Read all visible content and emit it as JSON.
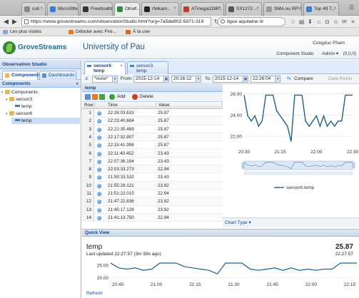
{
  "browser": {
    "tabs": [
      {
        "label": "coll...",
        "color": "#888888"
      },
      {
        "label": "MicroStre...",
        "color": "#3a7bd5"
      },
      {
        "label": "Freeboard",
        "color": "#333333"
      },
      {
        "label": "Obse...",
        "color": "#2d8a3a",
        "active": true
      },
      {
        "label": "rfelkam...",
        "color": "#222222"
      },
      {
        "label": "ATmega328P...",
        "color": "#c0392b"
      },
      {
        "label": "SX1272 ...",
        "color": "#555555"
      },
      {
        "label": "SMA ou RP-S...",
        "color": "#999999"
      },
      {
        "label": "Top 49 T...",
        "color": "#3a7bd5"
      }
    ],
    "url": "https://www.grovestreams.com/observationStudio.html?org=7a5de802-5d71-319",
    "search_value": "ligue aquitaine tir",
    "bookmarks": [
      "Les plus visités",
      "Débuter avec Fire...",
      "À la une"
    ]
  },
  "site": {
    "logo_text": "GroveStreams",
    "org_name": "University of Pau",
    "user": "Congduc Pham",
    "header_links": [
      "Component Studio",
      "Admin",
      "(0,0,0)"
    ]
  },
  "left": {
    "title": "Observation Studio",
    "tabs": [
      "Components",
      "Dashboards"
    ],
    "tree_title": "Components",
    "tree": [
      {
        "label": "Components",
        "type": "folder"
      },
      {
        "label": "sensor3",
        "type": "folder"
      },
      {
        "label": "temp",
        "type": "stream"
      },
      {
        "label": "sensor6",
        "type": "folder"
      },
      {
        "label": "temp",
        "type": "stream",
        "selected": true
      }
    ]
  },
  "stream_tabs": [
    {
      "line1": "sensor6",
      "line2": "temp"
    },
    {
      "line1": "sensor3",
      "line2": "temp"
    }
  ],
  "timebar": {
    "range": "*none*",
    "from_label": "From:",
    "from_date": "2015-12-14",
    "from_time": "20:26:12",
    "to_label": "To:",
    "to_date": "2015-12-14",
    "to_time": "22:26:04",
    "compare": "Compare",
    "data_points": "Data Points"
  },
  "grid": {
    "title": "temp",
    "add": "Add",
    "delete": "Delete",
    "headers": [
      "Row",
      "Time",
      "Value"
    ],
    "rows": [
      [
        "1",
        "22:26:03.633",
        "25.87"
      ],
      [
        "2",
        "22:23:40.604",
        "25.87"
      ],
      [
        "3",
        "22:21:35.489",
        "25.87"
      ],
      [
        "4",
        "22:17:32.907",
        "25.87"
      ],
      [
        "5",
        "22:15:41.998",
        "25.87"
      ],
      [
        "6",
        "22:11:40.452",
        "23.43"
      ],
      [
        "7",
        "22:07:36.184",
        "23.43"
      ],
      [
        "8",
        "22:03:33.273",
        "22.94"
      ],
      [
        "9",
        "21:59:33.532",
        "23.43"
      ],
      [
        "10",
        "21:55:28.121",
        "23.92"
      ],
      [
        "11",
        "21:51:22.015",
        "22.94"
      ],
      [
        "12",
        "21:47:22.836",
        "23.92"
      ],
      [
        "13",
        "21:45:17.126",
        "23.92"
      ],
      [
        "14",
        "21:41:13.750",
        "22.94"
      ]
    ]
  },
  "chart_data": [
    {
      "type": "line",
      "yticks": [
        "26.00",
        "24.00",
        "22.00"
      ],
      "ylim": [
        21.0,
        26.5
      ],
      "xticks": [
        "20:30",
        "21:15",
        "22:00",
        "22:30"
      ],
      "legend": "sensor6.temp",
      "color": "#1f5f8b",
      "series": [
        {
          "name": "sensor6.temp",
          "x": [
            0,
            4,
            8,
            12,
            16,
            20,
            24,
            28,
            32,
            36,
            40,
            44,
            48,
            52,
            56,
            60,
            64,
            68,
            72,
            76,
            80,
            84,
            88,
            92,
            96,
            100,
            104,
            108,
            112,
            116,
            120
          ],
          "values": [
            25.87,
            23.92,
            23.43,
            23.92,
            22.94,
            23.43,
            25.87,
            25.87,
            25.87,
            24.4,
            23.92,
            23.43,
            22.94,
            21.5,
            25.87,
            25.87,
            25.87,
            23.43,
            22.94,
            23.43,
            23.92,
            22.94,
            23.92,
            22.94,
            23.43,
            22.94,
            23.43,
            23.43,
            25.87,
            25.87,
            25.87
          ]
        }
      ]
    },
    {
      "type": "line",
      "title": "temp",
      "yticks": [
        "25.00",
        "20.00"
      ],
      "ylim": [
        19.0,
        27.0
      ],
      "xticks": [
        "20:45",
        "21:00",
        "21:15",
        "21:30",
        "21:45",
        "22:00",
        "22:15"
      ],
      "color": "#1f5f8b",
      "series": [
        {
          "name": "temp",
          "x": [
            0,
            4,
            8,
            12,
            16,
            20,
            24,
            28,
            32,
            36,
            40,
            44,
            48,
            52,
            56,
            60,
            64,
            68,
            72,
            76,
            80,
            84,
            88,
            92,
            96,
            100,
            104,
            108,
            112,
            116,
            120
          ],
          "values": [
            25.87,
            23.92,
            23.43,
            23.92,
            22.94,
            23.43,
            25.87,
            25.87,
            25.87,
            24.4,
            23.92,
            23.43,
            22.94,
            21.5,
            25.87,
            25.87,
            25.87,
            23.43,
            22.94,
            23.43,
            23.92,
            22.94,
            23.92,
            22.94,
            23.43,
            22.94,
            23.43,
            23.43,
            25.87,
            25.87,
            25.87
          ]
        }
      ]
    }
  ],
  "chart_footer": "Chart Type",
  "quick_view": {
    "title": "Quick View",
    "stream_name": "temp",
    "value": "25.87",
    "last_updated": "Last updated 22:27:57 (3m 59s ago)",
    "time": "22:27:57",
    "refresh": "Refresh"
  }
}
